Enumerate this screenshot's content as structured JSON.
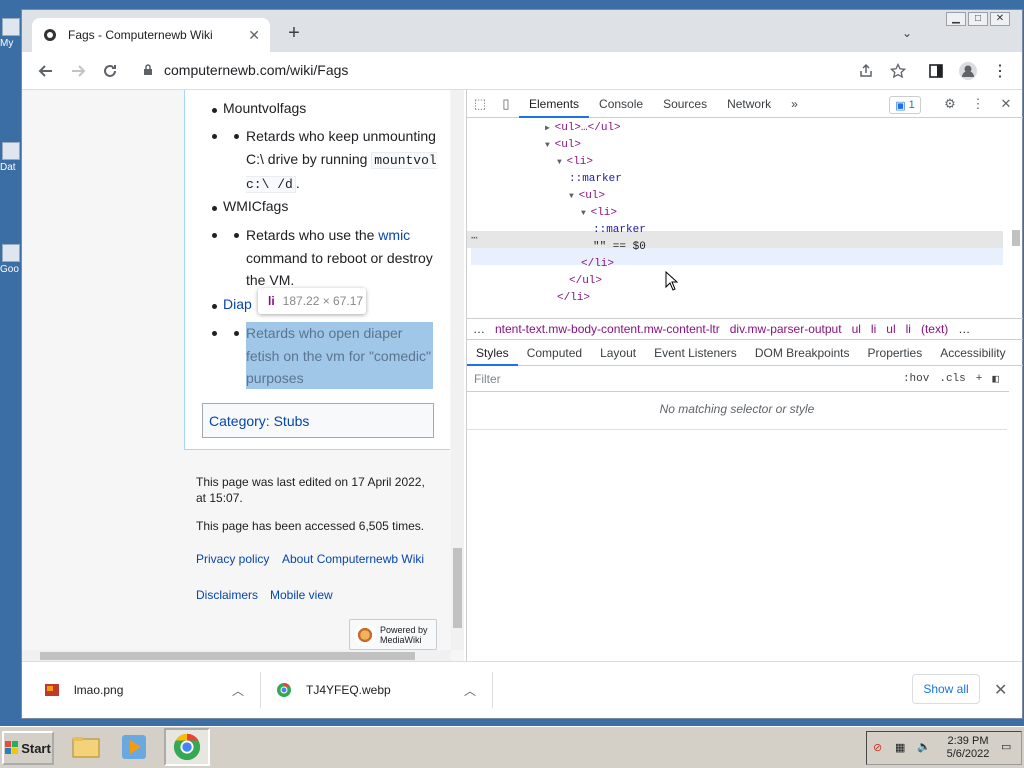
{
  "desktop": {
    "icons": [
      {
        "label": "My"
      },
      {
        "label": "Dat"
      },
      {
        "label": "Goo"
      }
    ]
  },
  "browser": {
    "tab_title": "Fags - Computernewb Wiki",
    "url": "computernewb.com/wiki/Fags",
    "window_buttons": [
      "▁",
      "□",
      "✕"
    ]
  },
  "page": {
    "items": [
      {
        "heading": "Mountvolfags"
      },
      {
        "heading": "WMICfags",
        "text_before": "Retards who use the ",
        "link": "wmic",
        "text_after": " command to reboot or destroy the VM."
      },
      {
        "heading": "Diap"
      }
    ],
    "mountvol_text_1": "Retards who keep unmounting C:\\ drive by running ",
    "mountvol_code": "mountvol c:\\ /d",
    "mountvol_text_2": ".",
    "diaper_text": "Retards who open diaper fetish on the vm for \"comedic\" purposes",
    "tooltip_tag": "li",
    "tooltip_dims": "187.22 × 67.17",
    "category_label": "Category:",
    "category_link": "Stubs",
    "last_edited": "This page was last edited on 17 April 2022, at 15:07.",
    "accessed": "This page has been accessed 6,505 times.",
    "footer_links": [
      "Privacy policy",
      "About Computernewb Wiki",
      "Disclaimers",
      "Mobile view"
    ],
    "powered_by": "Powered by",
    "mediawiki": "MediaWiki"
  },
  "devtools": {
    "tabs": [
      "Elements",
      "Console",
      "Sources",
      "Network"
    ],
    "active_tab": "Elements",
    "more": "»",
    "issues_count": "1",
    "dom_lines": [
      {
        "indent": 0,
        "toggle": "▶",
        "html": "<ul>…</ul>"
      },
      {
        "indent": 0,
        "toggle": "▼",
        "html": "<ul>"
      },
      {
        "indent": 1,
        "toggle": "▼",
        "html": "<li>"
      },
      {
        "indent": 2,
        "toggle": "",
        "html": "::marker"
      },
      {
        "indent": 2,
        "toggle": "▼",
        "html": "<ul>"
      },
      {
        "indent": 3,
        "toggle": "▼",
        "html": "<li>"
      },
      {
        "indent": 4,
        "toggle": "",
        "html": "::marker"
      },
      {
        "indent": 4,
        "toggle": "",
        "html": "\"\" == $0"
      },
      {
        "indent": 3,
        "toggle": "",
        "html": "</li>"
      },
      {
        "indent": 2,
        "toggle": "",
        "html": "</ul>"
      },
      {
        "indent": 1,
        "toggle": "",
        "html": "</li>"
      }
    ],
    "breadcrumbs": [
      "…",
      "ntent-text.mw-body-content.mw-content-ltr",
      "div.mw-parser-output",
      "ul",
      "li",
      "ul",
      "li",
      "(text)",
      "…"
    ],
    "sub_tabs": [
      "Styles",
      "Computed",
      "Layout",
      "Event Listeners",
      "DOM Breakpoints",
      "Properties",
      "Accessibility"
    ],
    "filter_placeholder": "Filter",
    "hov": ":hov",
    "cls": ".cls",
    "no_match": "No matching selector or style"
  },
  "downloads": {
    "items": [
      "lmao.png",
      "TJ4YFEQ.webp"
    ],
    "show_all": "Show all"
  },
  "taskbar": {
    "start": "Start",
    "time": "2:39 PM",
    "date": "5/6/2022"
  },
  "colors": {
    "accent": "#1a73e8",
    "link": "#0645ad",
    "highlight": "#6fa8dc",
    "desktop": "#3a6ea5"
  }
}
